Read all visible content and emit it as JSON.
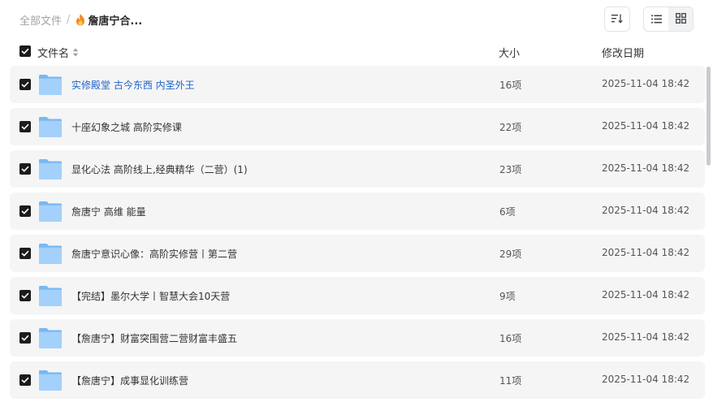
{
  "breadcrumb": {
    "root": "全部文件",
    "separator": "/",
    "current": "詹唐宁合..."
  },
  "columns": {
    "name": "文件名",
    "size": "大小",
    "date": "修改日期"
  },
  "colors": {
    "link": "#1e64c8",
    "folder": "#8ec5f5",
    "checkbox": "#1c1c1c"
  },
  "rows": [
    {
      "name": "实修殿堂 古今东西 内圣外王",
      "size": "16项",
      "date": "2025-11-04 18:42",
      "checked": true
    },
    {
      "name": "十座幻象之城 高阶实修课",
      "size": "22项",
      "date": "2025-11-04 18:42",
      "checked": true
    },
    {
      "name": "显化心法 高阶线上,经典精华（二营）(1)",
      "size": "23项",
      "date": "2025-11-04 18:42",
      "checked": true
    },
    {
      "name": "詹唐宁 高维 能量",
      "size": "6项",
      "date": "2025-11-04 18:42",
      "checked": true
    },
    {
      "name": "詹唐宁意识心像：高阶实修营丨第二营",
      "size": "29项",
      "date": "2025-11-04 18:42",
      "checked": true
    },
    {
      "name": "【完结】墨尔大学丨智慧大会10天营",
      "size": "9项",
      "date": "2025-11-04 18:42",
      "checked": true
    },
    {
      "name": "【詹唐宁】财富突围营二营财富丰盛五",
      "size": "16项",
      "date": "2025-11-04 18:42",
      "checked": true
    },
    {
      "name": "【詹唐宁】成事显化训练营",
      "size": "11项",
      "date": "2025-11-04 18:42",
      "checked": true
    }
  ]
}
